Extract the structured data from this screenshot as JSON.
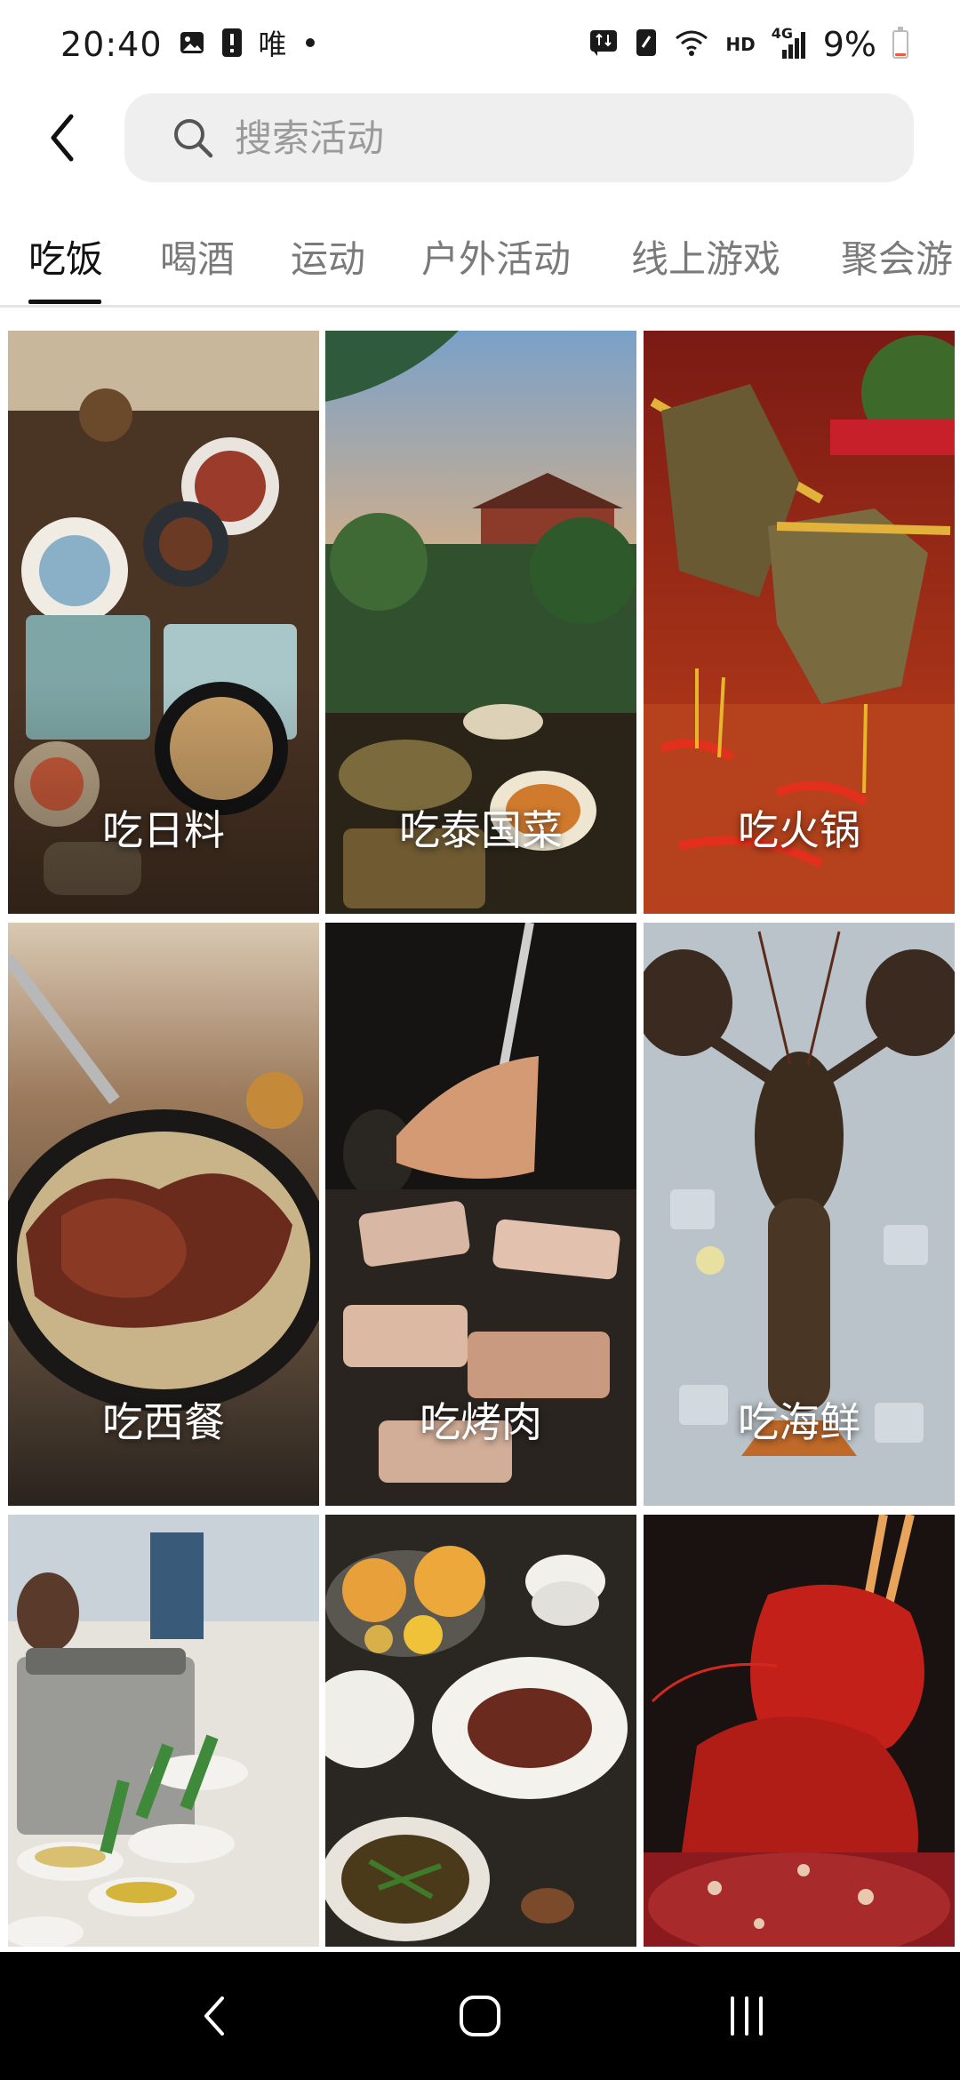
{
  "status_bar": {
    "time": "20:40",
    "carrier_text": "唯",
    "network_hd": "HD",
    "network_4g": "4G",
    "battery_percent": "9%",
    "battery_level": 0.09,
    "icons": [
      "gallery-icon",
      "alert-icon",
      "dot-icon",
      "sync-icon",
      "sim-icon",
      "wifi-icon",
      "signal-icon",
      "battery-icon"
    ]
  },
  "header": {
    "back_icon": "back-arrow-icon",
    "search_placeholder": "搜索活动"
  },
  "tabs": [
    {
      "label": "吃饭",
      "active": true
    },
    {
      "label": "喝酒",
      "active": false
    },
    {
      "label": "运动",
      "active": false
    },
    {
      "label": "户外活动",
      "active": false
    },
    {
      "label": "线上游戏",
      "active": false
    },
    {
      "label": "聚会游",
      "active": false
    }
  ],
  "grid": {
    "tiles": [
      {
        "label": "吃日料",
        "theme": "japanese-food"
      },
      {
        "label": "吃泰国菜",
        "theme": "thai-food"
      },
      {
        "label": "吃火锅",
        "theme": "hotpot"
      },
      {
        "label": "吃西餐",
        "theme": "western-steak"
      },
      {
        "label": "吃烤肉",
        "theme": "bbq"
      },
      {
        "label": "吃海鲜",
        "theme": "seafood-lobster"
      },
      {
        "label": "",
        "theme": "buffet"
      },
      {
        "label": "",
        "theme": "chinese-dishes"
      },
      {
        "label": "",
        "theme": "crayfish"
      }
    ]
  },
  "nav_bar": {
    "icons": [
      "recent-apps-icon",
      "home-icon",
      "back-icon"
    ]
  },
  "colors": {
    "tab_active": "#111111",
    "tab_inactive": "#7a7a7a",
    "search_bg": "#efefef",
    "nav_bg": "#000000"
  }
}
